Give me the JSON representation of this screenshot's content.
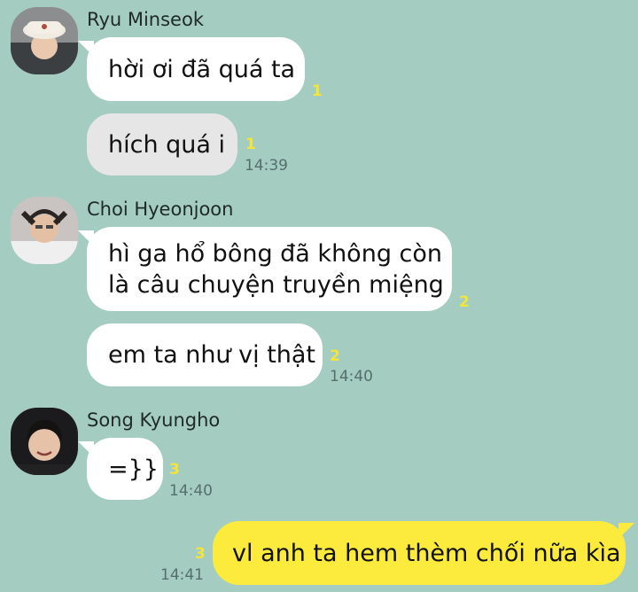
{
  "messages": [
    {
      "sender": "Ryu Minseok",
      "text": "hời ơi đã quá ta",
      "unread": "1"
    },
    {
      "text": "hích quá i",
      "unread": "1",
      "time": "14:39"
    },
    {
      "sender": "Choi Hyeonjoon",
      "lines": [
        "hì ga hổ bông đã không còn",
        "là câu chuyện truyền miệng"
      ],
      "unread": "2"
    },
    {
      "text": "em ta như vị thật",
      "unread": "2",
      "time": "14:40"
    },
    {
      "sender": "Song Kyungho",
      "text": "=}}",
      "unread": "3",
      "time": "14:40"
    },
    {
      "text": "vl anh ta hem thèm chối nữa kìa",
      "unread": "3",
      "time": "14:41"
    }
  ],
  "colors": {
    "background": "#a4ccc1",
    "incoming_bubble": "#ffffff",
    "selected_bubble": "#e6e6e6",
    "outgoing_bubble": "#fcea3d",
    "unread_count": "#f4e53a"
  },
  "icons": [
    "avatar-ryu-minseok",
    "avatar-choi-hyeonjoon",
    "avatar-song-kyungho"
  ]
}
